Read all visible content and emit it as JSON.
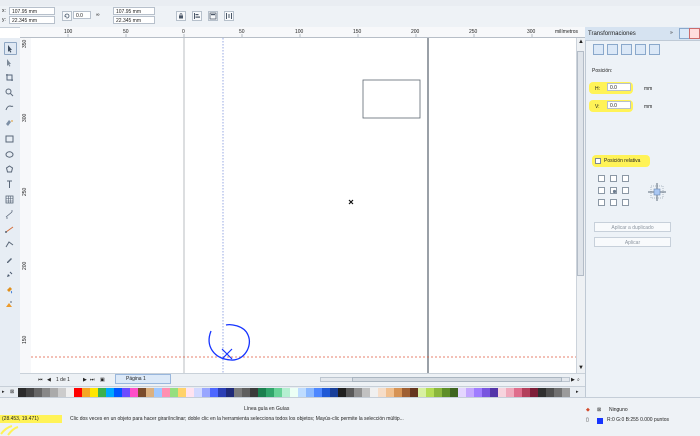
{
  "properties": {
    "x_label": "x:",
    "x_value": "107.95 mm",
    "y_label": "y:",
    "y_value": "22.345 mm",
    "rotation": "0.0",
    "width_value": "107.95 mm",
    "height_value": "22.345 mm"
  },
  "ruler": {
    "unit_label": "milímetros",
    "top_ticks": [
      "100",
      "50",
      "0",
      "50",
      "100",
      "150",
      "200",
      "250",
      "300"
    ],
    "left_ticks": [
      "350",
      "300",
      "250",
      "200",
      "150",
      "100",
      "50"
    ]
  },
  "docker": {
    "title": "Transformaciones",
    "position_label": "Posición:",
    "h_label": "H:",
    "h_value": "0.0",
    "v_label": "V:",
    "v_value": "0.0",
    "unit_h": "mm",
    "unit_v": "mm",
    "relative_label": "Posición relativa",
    "apply_copy": "Aplicar a duplicado",
    "apply": "Aplicar"
  },
  "page_nav": {
    "page_count": "1 de 1",
    "page_tab": "Página 1"
  },
  "status": {
    "guide_label": "Línea guía en Guías",
    "coords": "(28.453, 19.471)",
    "hint": "Clic dos veces en un objeto para hacer girar/inclinar; doble clic en la herramienta selecciona todos los objetos; Mayús-clic permite la selección múltip...",
    "fill_label": "Ninguno",
    "outline_label": "R:0 G:0 B:255  0.000 puntos"
  },
  "colors": {
    "accent_highlight": "#fff357",
    "guide_blue": "#2c51d8",
    "guide_red": "#e05a3e",
    "outline_blue": "#1634ff"
  },
  "icons": [
    "pick-tool-icon",
    "shape-tool-icon",
    "crop-tool-icon",
    "zoom-tool-icon",
    "freehand-tool-icon",
    "smart-fill-tool-icon",
    "rectangle-tool-icon",
    "ellipse-tool-icon",
    "polygon-tool-icon",
    "text-tool-icon",
    "table-tool-icon",
    "parallel-dimension-tool-icon",
    "connector-tool-icon",
    "blend-tool-icon",
    "eyedropper-tool-icon",
    "outline-pen-tool-icon",
    "fill-tool-icon",
    "interactive-fill-tool-icon"
  ]
}
